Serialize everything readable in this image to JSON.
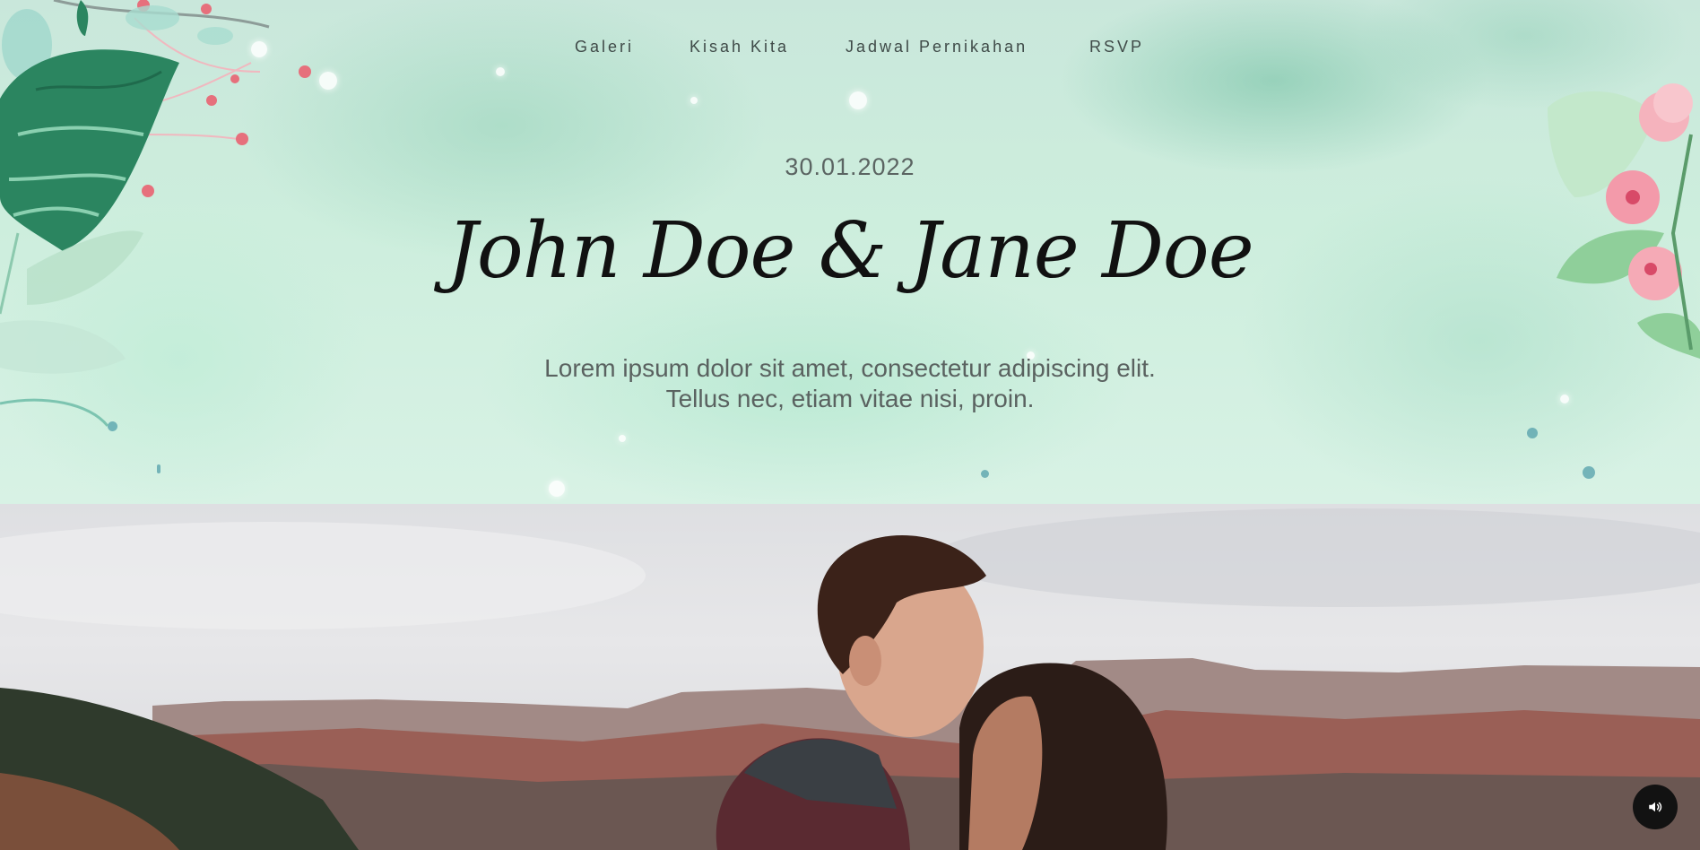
{
  "nav": {
    "items": [
      {
        "label": "Galeri"
      },
      {
        "label": "Kisah Kita"
      },
      {
        "label": "Jadwal Pernikahan"
      },
      {
        "label": "RSVP"
      }
    ]
  },
  "hero": {
    "date": "30.01.2022",
    "names": "John Doe & Jane Doe",
    "tagline_line1": "Lorem ipsum dolor sit amet, consectetur adipiscing elit.",
    "tagline_line2": "Tellus nec, etiam vitae nisi, proin."
  },
  "photo": {
    "subject": "couple-portrait"
  },
  "controls": {
    "sound_icon": "speaker-icon"
  },
  "colors": {
    "hero_background": "#cdeedd",
    "text_dark": "#111111",
    "text_muted": "#5a6260",
    "button_dark": "#121212"
  }
}
